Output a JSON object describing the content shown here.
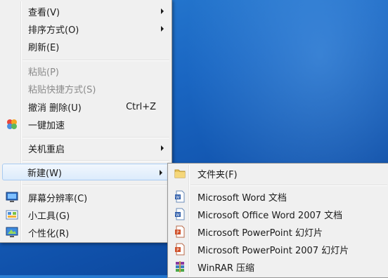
{
  "context_menu": {
    "items": [
      {
        "label": "查看(V)",
        "has_submenu": true
      },
      {
        "label": "排序方式(O)",
        "has_submenu": true
      },
      {
        "label": "刷新(E)"
      },
      {
        "label": "粘贴(P)",
        "disabled": true
      },
      {
        "label": "粘贴快捷方式(S)",
        "disabled": true
      },
      {
        "label": "撤消 删除(U)",
        "shortcut": "Ctrl+Z"
      },
      {
        "label": "一键加速",
        "icon": "speed-up-icon"
      },
      {
        "label": "关机重启",
        "has_submenu": true
      },
      {
        "label": "新建(W)",
        "has_submenu": true,
        "highlighted": true
      },
      {
        "label": "屏幕分辨率(C)",
        "icon": "screen-resolution-icon"
      },
      {
        "label": "小工具(G)",
        "icon": "gadgets-icon"
      },
      {
        "label": "个性化(R)",
        "icon": "personalize-icon"
      }
    ]
  },
  "new_submenu": {
    "items": [
      {
        "label": "文件夹(F)",
        "icon": "folder-icon"
      },
      {
        "label": "Microsoft Word 文档",
        "icon": "word-document-icon"
      },
      {
        "label": "Microsoft Office Word 2007 文档",
        "icon": "word-2007-document-icon"
      },
      {
        "label": "Microsoft PowerPoint 幻灯片",
        "icon": "powerpoint-icon"
      },
      {
        "label": "Microsoft PowerPoint 2007 幻灯片",
        "icon": "powerpoint-2007-icon"
      },
      {
        "label": "WinRAR 压缩",
        "icon": "winrar-icon"
      }
    ]
  },
  "colors": {
    "menu_bg": "#f0f0f0",
    "highlight_border": "#a8cbf1",
    "desktop": "#1a66c2"
  }
}
